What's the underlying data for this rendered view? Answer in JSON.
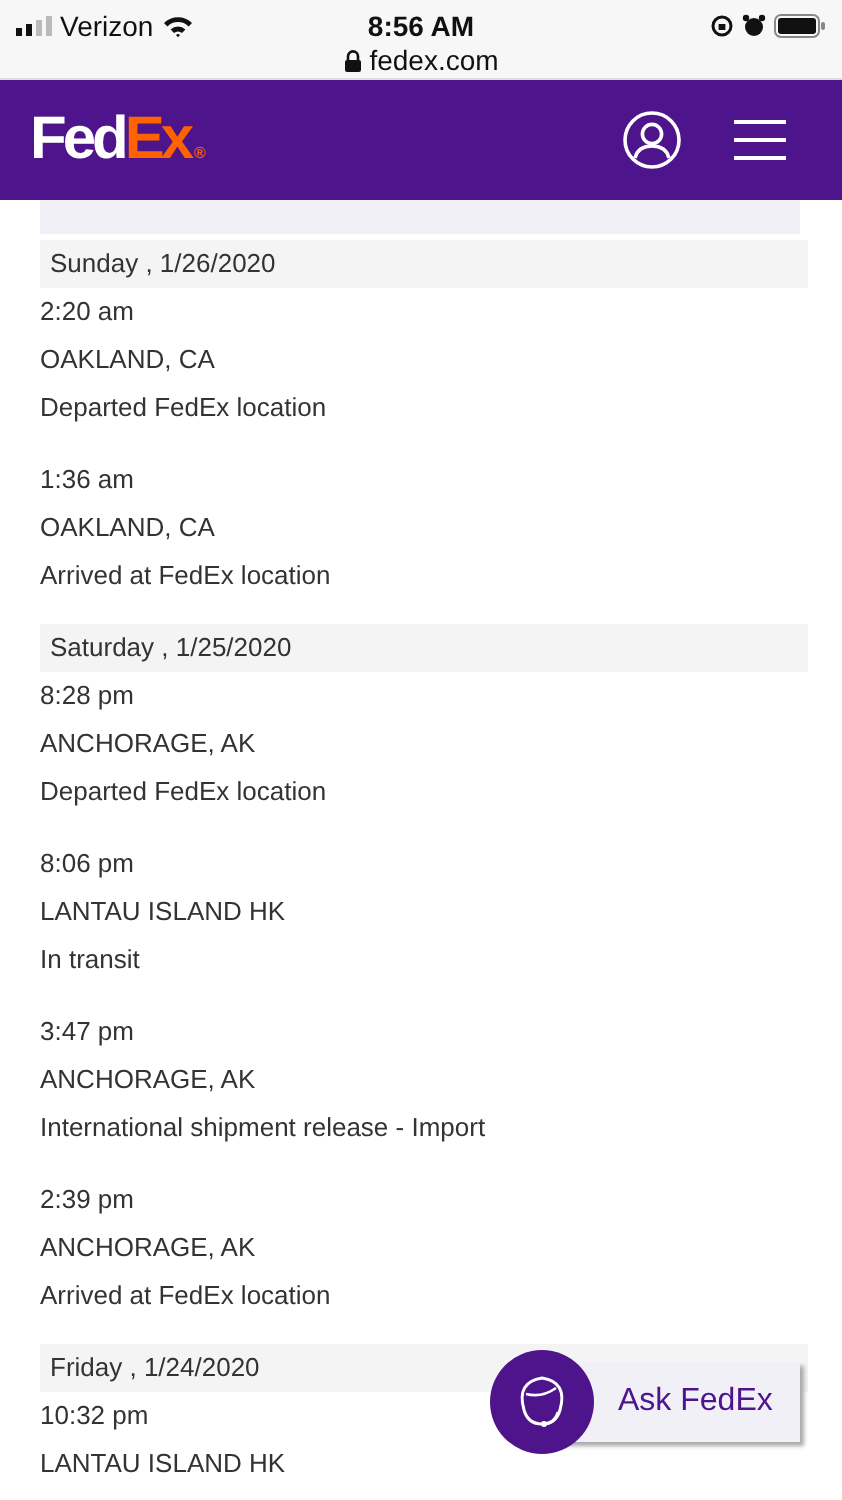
{
  "status_bar": {
    "carrier": "Verizon",
    "time": "8:56 AM",
    "url": "fedex.com"
  },
  "header": {
    "logo": {
      "main": "Fed",
      "accent": "Ex",
      "mark": "®"
    }
  },
  "days": [
    {
      "date": "Sunday , 1/26/2020",
      "events": [
        {
          "time": "2:20 am",
          "location": "OAKLAND, CA",
          "status": "Departed FedEx location"
        },
        {
          "time": "1:36 am",
          "location": "OAKLAND, CA",
          "status": "Arrived at FedEx location"
        }
      ]
    },
    {
      "date": "Saturday , 1/25/2020",
      "events": [
        {
          "time": "8:28 pm",
          "location": "ANCHORAGE, AK",
          "status": "Departed FedEx location"
        },
        {
          "time": "8:06 pm",
          "location": "LANTAU ISLAND HK",
          "status": "In transit"
        },
        {
          "time": "3:47 pm",
          "location": "ANCHORAGE, AK",
          "status": "International shipment release - Import"
        },
        {
          "time": "2:39 pm",
          "location": "ANCHORAGE, AK",
          "status": "Arrived at FedEx location"
        }
      ]
    },
    {
      "date": "Friday , 1/24/2020",
      "events": [
        {
          "time": "10:32 pm",
          "location": "LANTAU ISLAND HK"
        }
      ]
    }
  ],
  "ask_button": {
    "label": "Ask FedEx"
  }
}
